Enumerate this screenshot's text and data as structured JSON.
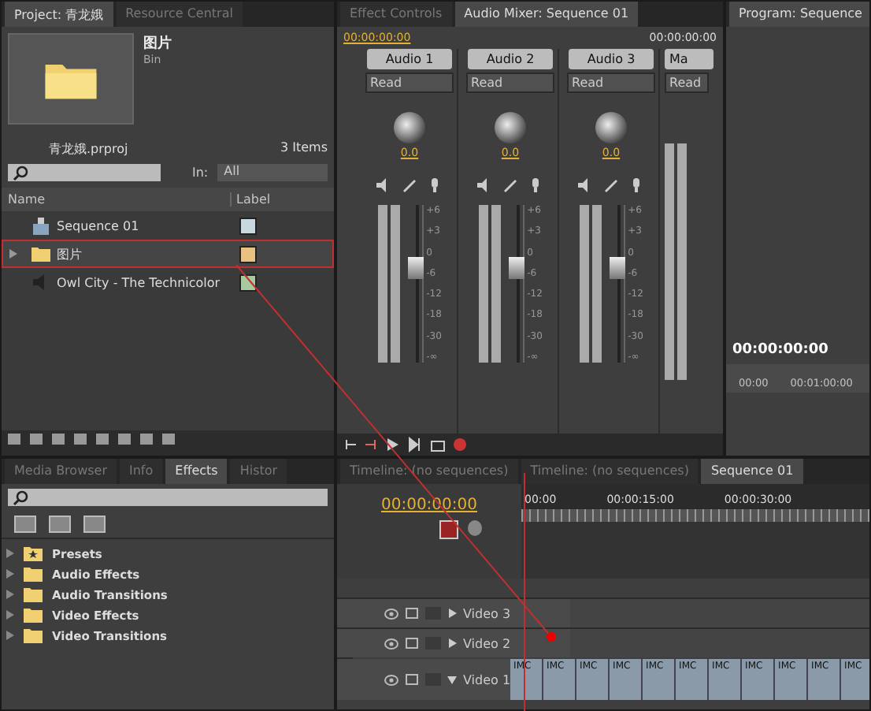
{
  "project": {
    "tabs": [
      {
        "label": "Project: 青龙娥",
        "selected": true
      },
      {
        "label": "Resource Central",
        "selected": false
      }
    ],
    "preview": {
      "title": "图片",
      "subtitle": "Bin"
    },
    "file": "青龙娥.prproj",
    "count": "3 Items",
    "in_label": "In:",
    "in_value": "All",
    "columns": [
      "Name",
      "Label"
    ],
    "items": [
      {
        "kind": "sequence",
        "name": "Sequence 01",
        "color": "#c8d8e0",
        "annotated": false
      },
      {
        "kind": "folder",
        "name": "图片",
        "color": "#e8c080",
        "annotated": true
      },
      {
        "kind": "audio",
        "name": "Owl City - The Technicolor",
        "color": "#a8c8a0",
        "annotated": false
      }
    ]
  },
  "mixer": {
    "tabs": [
      {
        "label": "Effect Controls",
        "selected": false
      },
      {
        "label": "Audio Mixer: Sequence 01",
        "selected": true
      }
    ],
    "timecode_left": "00:00:00:00",
    "timecode_right": "00:00:00:00",
    "channels": [
      {
        "name": "Audio 1",
        "mode": "Read",
        "pan": "0.0",
        "level": 0.6,
        "scale": [
          "+6",
          "+3",
          "0",
          "-6",
          "-12",
          "-18",
          "-30",
          "-∞"
        ]
      },
      {
        "name": "Audio 2",
        "mode": "Read",
        "pan": "0.0",
        "level": 0.6,
        "scale": [
          "+6",
          "+3",
          "0",
          "-6",
          "-12",
          "-18",
          "-30",
          "-∞"
        ]
      },
      {
        "name": "Audio 3",
        "mode": "Read",
        "pan": "0.0",
        "level": 0.6,
        "scale": [
          "+6",
          "+3",
          "0",
          "-6",
          "-12",
          "-18",
          "-30",
          "-∞"
        ]
      }
    ],
    "master": {
      "name": "Ma",
      "mode": "Read"
    }
  },
  "program": {
    "tab": "Program: Sequence",
    "timecode": "00:00:00:00",
    "ruler": [
      "00:00",
      "00:01:00:00"
    ]
  },
  "effects": {
    "tabs": [
      {
        "label": "Media Browser",
        "selected": false
      },
      {
        "label": "Info",
        "selected": false
      },
      {
        "label": "Effects",
        "selected": true
      },
      {
        "label": "Histor",
        "selected": false
      }
    ],
    "items": [
      {
        "kind": "presets",
        "label": "Presets"
      },
      {
        "kind": "folder",
        "label": "Audio Effects"
      },
      {
        "kind": "folder",
        "label": "Audio Transitions"
      },
      {
        "kind": "folder",
        "label": "Video Effects"
      },
      {
        "kind": "folder",
        "label": "Video Transitions"
      }
    ]
  },
  "timeline": {
    "tabs": [
      {
        "label": "Timeline: (no sequences)",
        "selected": false
      },
      {
        "label": "Timeline: (no sequences)",
        "selected": false
      },
      {
        "label": "Sequence 01",
        "selected": true
      }
    ],
    "timecode": "00:00:00:00",
    "ruler": [
      "00:00",
      "00:00:15:00",
      "00:00:30:00"
    ],
    "tracks": [
      {
        "name": "Video 3",
        "expanded": false
      },
      {
        "name": "Video 2",
        "expanded": false
      },
      {
        "name": "Video 1",
        "expanded": true,
        "clips": [
          "IMC",
          "IMC",
          "IMC",
          "IMC",
          "IMC",
          "IMC",
          "IMC",
          "IMC",
          "IMC",
          "IMC",
          "IMC"
        ]
      }
    ]
  }
}
